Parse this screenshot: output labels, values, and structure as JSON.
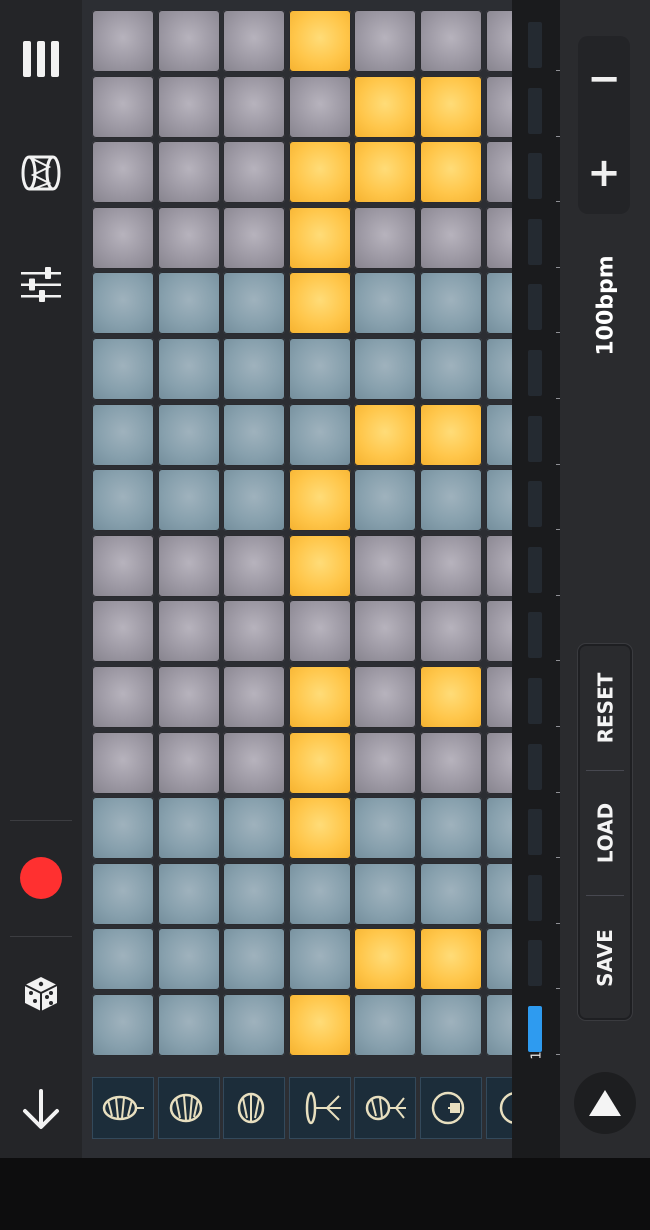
{
  "toolbar": {
    "icons": [
      "menu-icon",
      "drum-icon",
      "mixer-icon",
      "record-icon",
      "dice-icon",
      "arrow-down-icon"
    ]
  },
  "colors": {
    "pad_on": "#ffc64a",
    "pad_off_gray": "#9c98a3",
    "pad_off_blue": "#87a0ad",
    "record": "#ff3030",
    "step_active": "#2e9bf0"
  },
  "grid": {
    "columns": 7,
    "rows": 16,
    "row_groups": [
      "gray",
      "gray",
      "gray",
      "gray",
      "blue",
      "blue",
      "blue",
      "blue",
      "gray",
      "gray",
      "gray",
      "gray",
      "blue",
      "blue",
      "blue",
      "blue"
    ],
    "active": [
      [
        0,
        0,
        0,
        1,
        0,
        0,
        0
      ],
      [
        0,
        0,
        0,
        0,
        1,
        1,
        0
      ],
      [
        0,
        0,
        0,
        1,
        1,
        1,
        0
      ],
      [
        0,
        0,
        0,
        1,
        0,
        0,
        0
      ],
      [
        0,
        0,
        0,
        1,
        0,
        0,
        0
      ],
      [
        0,
        0,
        0,
        0,
        0,
        0,
        0
      ],
      [
        0,
        0,
        0,
        0,
        1,
        1,
        0
      ],
      [
        0,
        0,
        0,
        1,
        0,
        0,
        0
      ],
      [
        0,
        0,
        0,
        1,
        0,
        0,
        0
      ],
      [
        0,
        0,
        0,
        0,
        0,
        0,
        0
      ],
      [
        0,
        0,
        0,
        1,
        0,
        1,
        0
      ],
      [
        0,
        0,
        0,
        1,
        0,
        0,
        0
      ],
      [
        0,
        0,
        0,
        1,
        0,
        0,
        0
      ],
      [
        0,
        0,
        0,
        0,
        0,
        0,
        0
      ],
      [
        0,
        0,
        0,
        0,
        1,
        1,
        0
      ],
      [
        0,
        0,
        0,
        1,
        0,
        0,
        0
      ]
    ],
    "instruments": [
      "bass-drum-icon",
      "snare-drum-icon",
      "tom-drum-icon",
      "hihat-icon",
      "floor-tom-icon",
      "cowbell-icon",
      "cymbal-icon"
    ]
  },
  "steps": {
    "count": 16,
    "active_index": 15,
    "current_label": "1"
  },
  "tempo": {
    "minus_label": "−",
    "plus_label": "+",
    "bpm_label": "100bpm"
  },
  "file": {
    "reset_label": "RESET",
    "load_label": "LOAD",
    "save_label": "SAVE"
  },
  "transport": {
    "play_icon": "play-icon"
  }
}
